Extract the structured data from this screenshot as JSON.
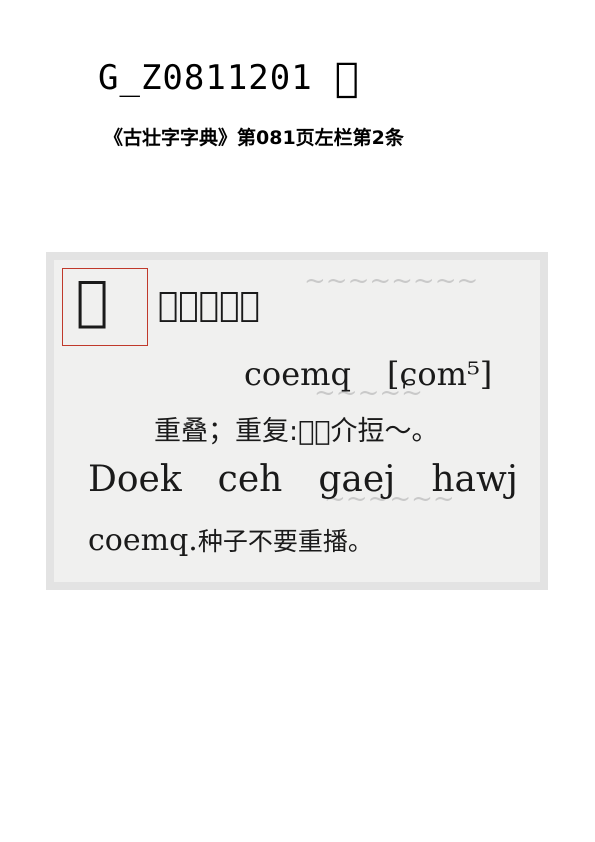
{
  "header": {
    "code": "G_Z0811201",
    "character": "𰨪",
    "source": "《古壮字字典》第081页左栏第2条"
  },
  "entry": {
    "headword": "𰨪",
    "variants": "（𰨫、𰨬）",
    "romanization": "coemq",
    "ipa": "[ɕom⁵]",
    "definition": "重叠；重复:𫀂𬾐介𢭃～。",
    "example_words": [
      "Doek",
      "ceh",
      "gaej",
      "hawj"
    ],
    "example_end_latin": "coemq.",
    "example_translation": "种子不要重播。"
  }
}
